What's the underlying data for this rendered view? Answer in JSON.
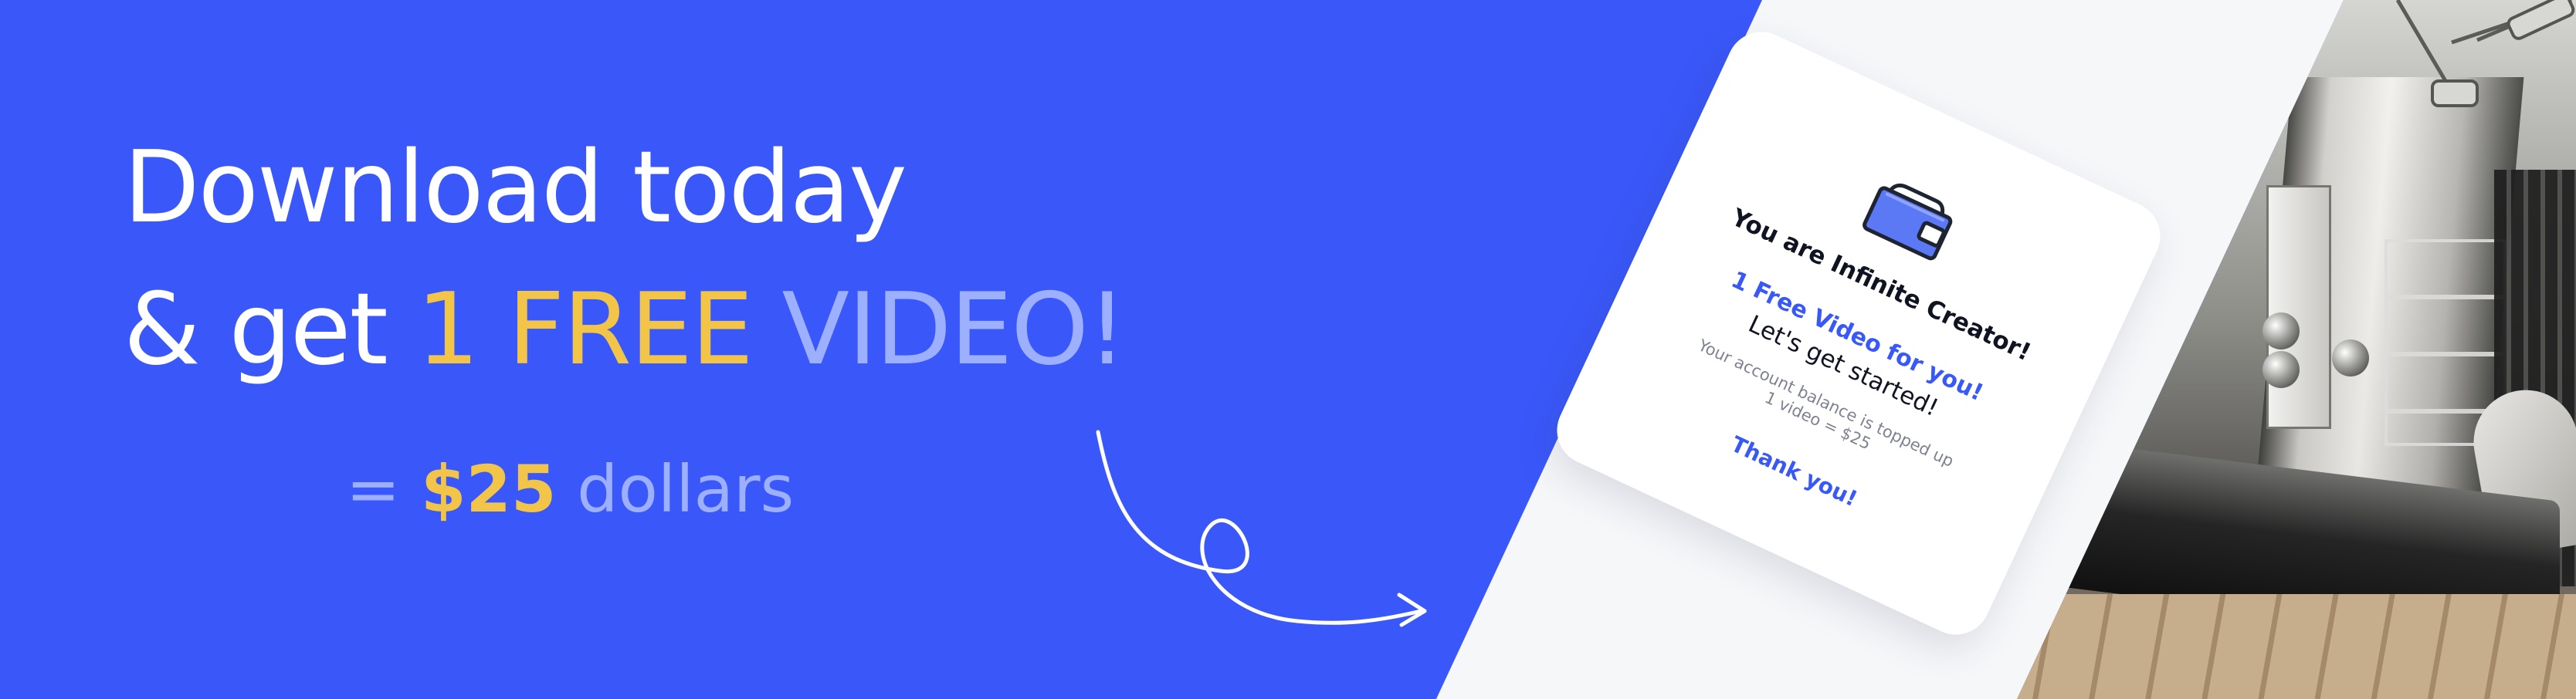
{
  "banner": {
    "headline_line1": "Download today",
    "headline_prefix": "& get ",
    "headline_highlight": "1 FREE",
    "headline_suffix": " VIDEO!",
    "price_prefix": "= ",
    "price_amount": "$25",
    "price_suffix": " dollars"
  },
  "card": {
    "title": "You are Infinite Creator!",
    "offer": "1 Free Video for you!",
    "start": "Let's get started!",
    "note_line1": "Your account balance is topped up",
    "note_line2": "1 video = $25",
    "thanks": "Thank you!"
  },
  "colors": {
    "primary": "#3a58f9",
    "accent_yellow": "#f2c548",
    "accent_light_blue": "#9db0ff",
    "card_background": "#ffffff"
  },
  "icons": {
    "wallet": "wallet-icon",
    "arrow": "curly-arrow-icon"
  }
}
